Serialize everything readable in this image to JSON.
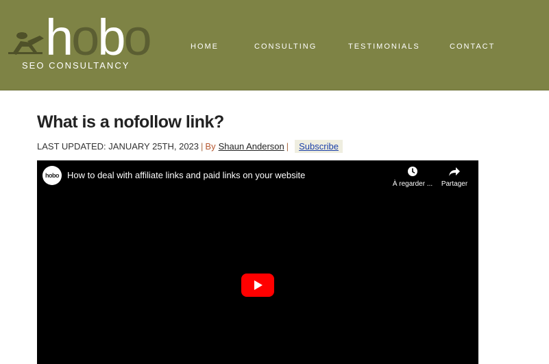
{
  "header": {
    "logo": {
      "wordmark_bright": "h",
      "wordmark_mid": "o",
      "wordmark_bright2": "b",
      "wordmark_dim": "o",
      "tagline": "SEO CONSULTANCY"
    },
    "nav": [
      {
        "label": "HOME"
      },
      {
        "label": "CONSULTING"
      },
      {
        "label": "TESTIMONIALS"
      },
      {
        "label": "CONTACT"
      }
    ],
    "background_color": "#7e8345"
  },
  "article": {
    "title": "What is a nofollow link?",
    "updated_label": "LAST UPDATED: JANUARY 25TH, 2023",
    "separator": "|",
    "by_label": "By",
    "author": "Shaun Anderson",
    "subscribe_label": "Subscribe"
  },
  "video": {
    "channel_avatar_text": "hobo",
    "title": "How to deal with affiliate links and paid links on your website",
    "watch_later_label": "À regarder ...",
    "share_label": "Partager",
    "play_icon": "youtube-play-icon",
    "play_color": "#ff0000"
  }
}
